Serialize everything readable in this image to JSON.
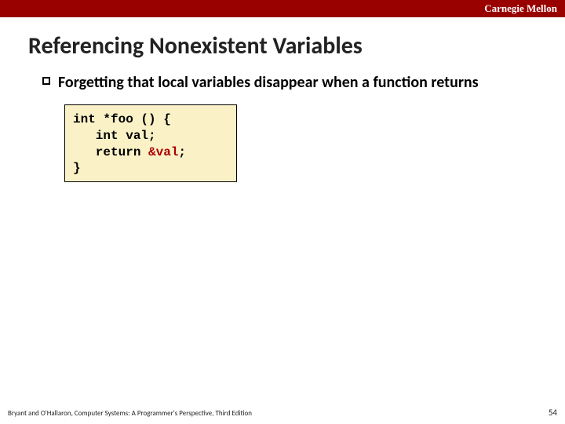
{
  "header": {
    "institution": "Carnegie Mellon"
  },
  "title": "Referencing Nonexistent Variables",
  "bullet": "Forgetting that local variables disappear when a function returns",
  "code": {
    "line1": "int *foo () {",
    "line2": "   int val;",
    "line3": "",
    "line4_a": "   return ",
    "line4_hl": "&val",
    "line4_b": ";",
    "line5": "}"
  },
  "footer": {
    "attribution": "Bryant and O'Hallaron, Computer Systems: A Programmer's Perspective, Third Edition",
    "page": "54"
  }
}
